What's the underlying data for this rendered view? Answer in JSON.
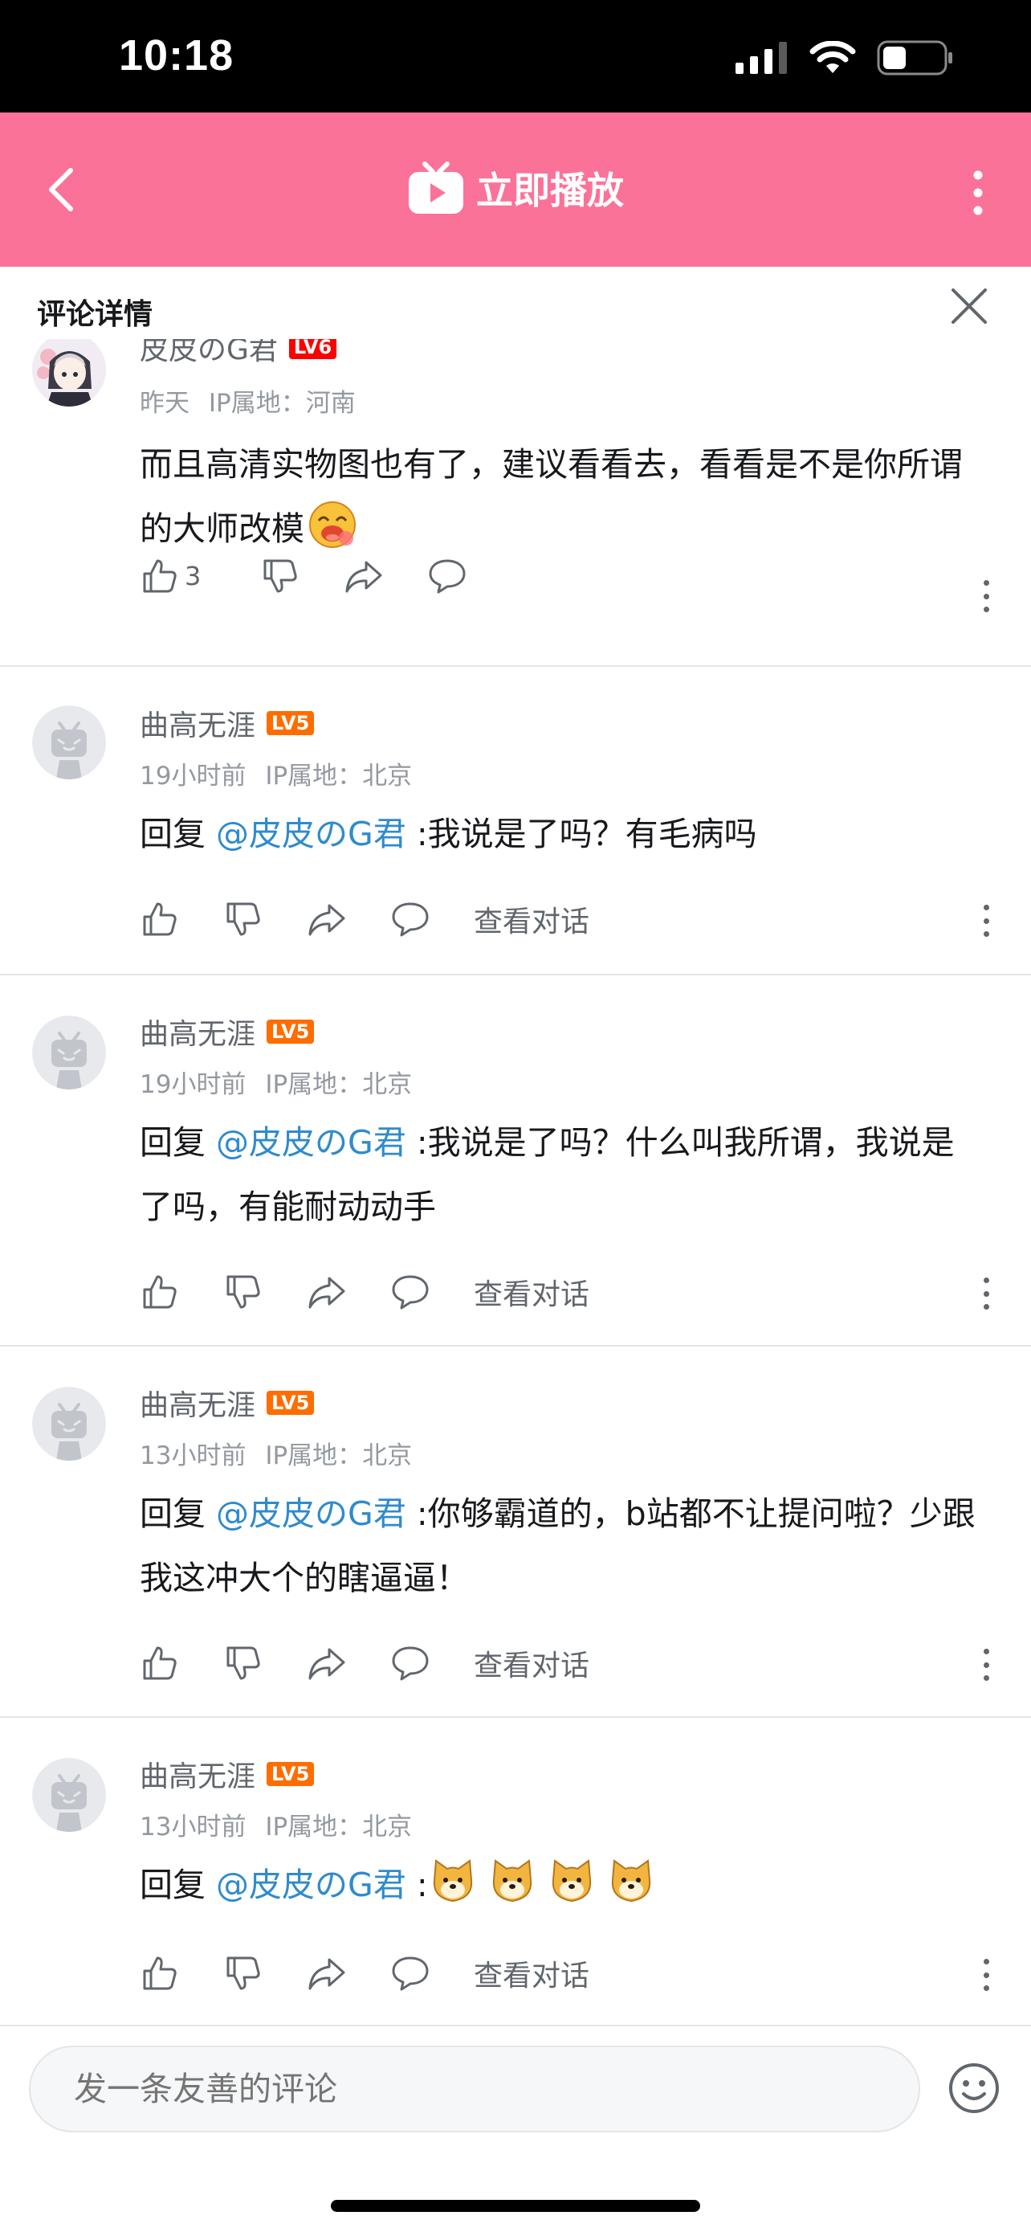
{
  "status_bar": {
    "time": "10:18",
    "battery_level": 0.3
  },
  "nav": {
    "title": "立即播放",
    "color": "#fb7299"
  },
  "panel": {
    "title": "评论详情"
  },
  "comments": [
    {
      "username": "皮皮のG君",
      "level": "LV6",
      "time": "昨天",
      "ip": "IP属地：河南",
      "text": "而且高清实物图也有了，建议看看去，看看是不是你所谓的大师改模",
      "emoji": "doge-laugh-emoji",
      "likes": "3"
    },
    {
      "username": "曲高无涯",
      "level": "LV5",
      "time": "19小时前",
      "ip": "IP属地：北京",
      "reply_prefix": "回复 ",
      "mention": "@皮皮のG君",
      "text": " :我说是了吗？有毛病吗",
      "view_conversation": "查看对话"
    },
    {
      "username": "曲高无涯",
      "level": "LV5",
      "time": "19小时前",
      "ip": "IP属地：北京",
      "reply_prefix": "回复 ",
      "mention": "@皮皮のG君",
      "text": " :我说是了吗？什么叫我所谓，我说是了吗，有能耐动动手",
      "view_conversation": "查看对话"
    },
    {
      "username": "曲高无涯",
      "level": "LV5",
      "time": "13小时前",
      "ip": "IP属地：北京",
      "reply_prefix": "回复 ",
      "mention": "@皮皮のG君",
      "text": " :你够霸道的，b站都不让提问啦？少跟我这冲大个的瞎逼逼！",
      "view_conversation": "查看对话"
    },
    {
      "username": "曲高无涯",
      "level": "LV5",
      "time": "13小时前",
      "ip": "IP属地：北京",
      "reply_prefix": "回复 ",
      "mention": "@皮皮のG君",
      "text": " :",
      "emoji": "doge-emoji",
      "view_conversation": "查看对话"
    }
  ],
  "input": {
    "placeholder": "发一条友善的评论"
  },
  "colors": {
    "mention": "#2f8bcc",
    "level5": "#ff6c00",
    "level6": "#ff0000"
  }
}
